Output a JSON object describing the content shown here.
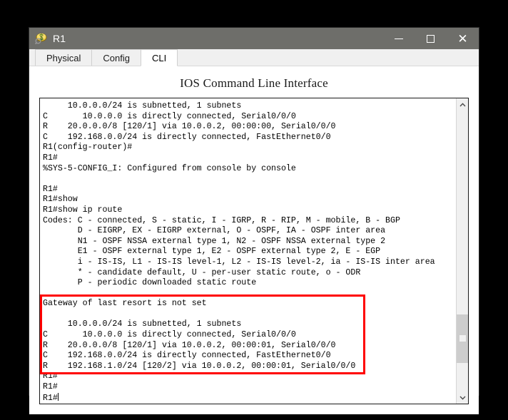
{
  "window": {
    "title": "R1",
    "icon": "router-icon",
    "controls": {
      "minimize": "minimize-icon",
      "maximize": "maximize-icon",
      "close": "close-icon"
    }
  },
  "tabs": [
    {
      "label": "Physical",
      "active": false
    },
    {
      "label": "Config",
      "active": false
    },
    {
      "label": "CLI",
      "active": true
    }
  ],
  "heading": "IOS Command Line Interface",
  "terminal": {
    "lines": [
      "     10.0.0.0/24 is subnetted, 1 subnets",
      "C       10.0.0.0 is directly connected, Serial0/0/0",
      "R    20.0.0.0/8 [120/1] via 10.0.0.2, 00:00:00, Serial0/0/0",
      "C    192.168.0.0/24 is directly connected, FastEthernet0/0",
      "R1(config-router)#",
      "R1#",
      "%SYS-5-CONFIG_I: Configured from console by console",
      "",
      "R1#",
      "R1#show",
      "R1#show ip route",
      "Codes: C - connected, S - static, I - IGRP, R - RIP, M - mobile, B - BGP",
      "       D - EIGRP, EX - EIGRP external, O - OSPF, IA - OSPF inter area",
      "       N1 - OSPF NSSA external type 1, N2 - OSPF NSSA external type 2",
      "       E1 - OSPF external type 1, E2 - OSPF external type 2, E - EGP",
      "       i - IS-IS, L1 - IS-IS level-1, L2 - IS-IS level-2, ia - IS-IS inter area",
      "       * - candidate default, U - per-user static route, o - ODR",
      "       P - periodic downloaded static route",
      "",
      "Gateway of last resort is not set",
      "",
      "     10.0.0.0/24 is subnetted, 1 subnets",
      "C       10.0.0.0 is directly connected, Serial0/0/0",
      "R    20.0.0.0/8 [120/1] via 10.0.0.2, 00:00:01, Serial0/0/0",
      "C    192.168.0.0/24 is directly connected, FastEthernet0/0",
      "R    192.168.1.0/24 [120/2] via 10.0.0.2, 00:00:01, Serial0/0/0",
      "R1#",
      "R1#"
    ],
    "prompt_line": "R1#",
    "cursor_visible": true
  },
  "annotation": {
    "color": "#ff0000",
    "label": "routing-table-highlight"
  },
  "scrollbar": {
    "up_arrow": "chevron-up-icon",
    "down_arrow": "chevron-down-icon",
    "thumb_position": "near-bottom"
  },
  "colors": {
    "titlebar": "#6e6e6a",
    "tab_active_bg": "#ffffff",
    "tab_inactive_bg": "#f0f0f0",
    "annotation": "#ff0000",
    "desktop": "#000000"
  }
}
